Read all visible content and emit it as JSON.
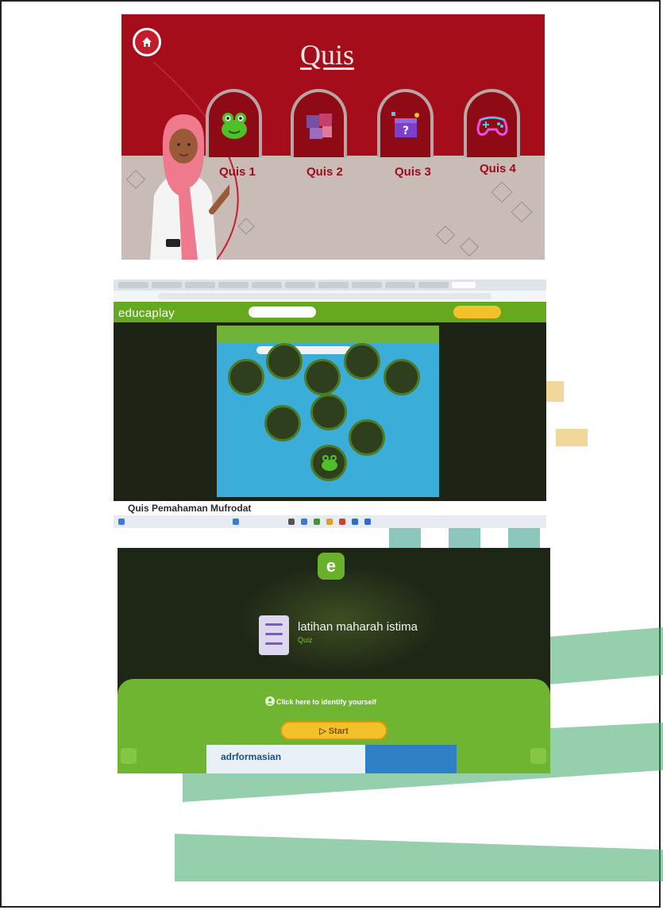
{
  "colors": {
    "quis_red": "#a50d1a",
    "floor_gray": "#c9bcb7",
    "educaplay_green": "#66a91e",
    "start_yellow": "#f3c22b",
    "watermark_green": "#3c9a6b",
    "watermark_gold": "#e8b84a"
  },
  "quis_menu": {
    "title": "Quis",
    "home_icon": "home-icon",
    "items": [
      {
        "label": "Quis 1",
        "icon": "frog-icon"
      },
      {
        "label": "Quis 2",
        "icon": "puzzle-icon"
      },
      {
        "label": "Quis 3",
        "icon": "question-box-icon"
      },
      {
        "label": "Quis 4",
        "icon": "gamepad-icon"
      }
    ]
  },
  "educaplay_screen": {
    "logo": "educaplay",
    "caption": "Quis Pemahaman Mufrodat"
  },
  "activity_screen": {
    "logo_letter": "e",
    "title": "latihan maharah istima",
    "subtitle": "Quiz",
    "identify_prompt": "Click here to identify yourself",
    "start_label": "▷ Start",
    "ad_brand": "adrformasian"
  }
}
